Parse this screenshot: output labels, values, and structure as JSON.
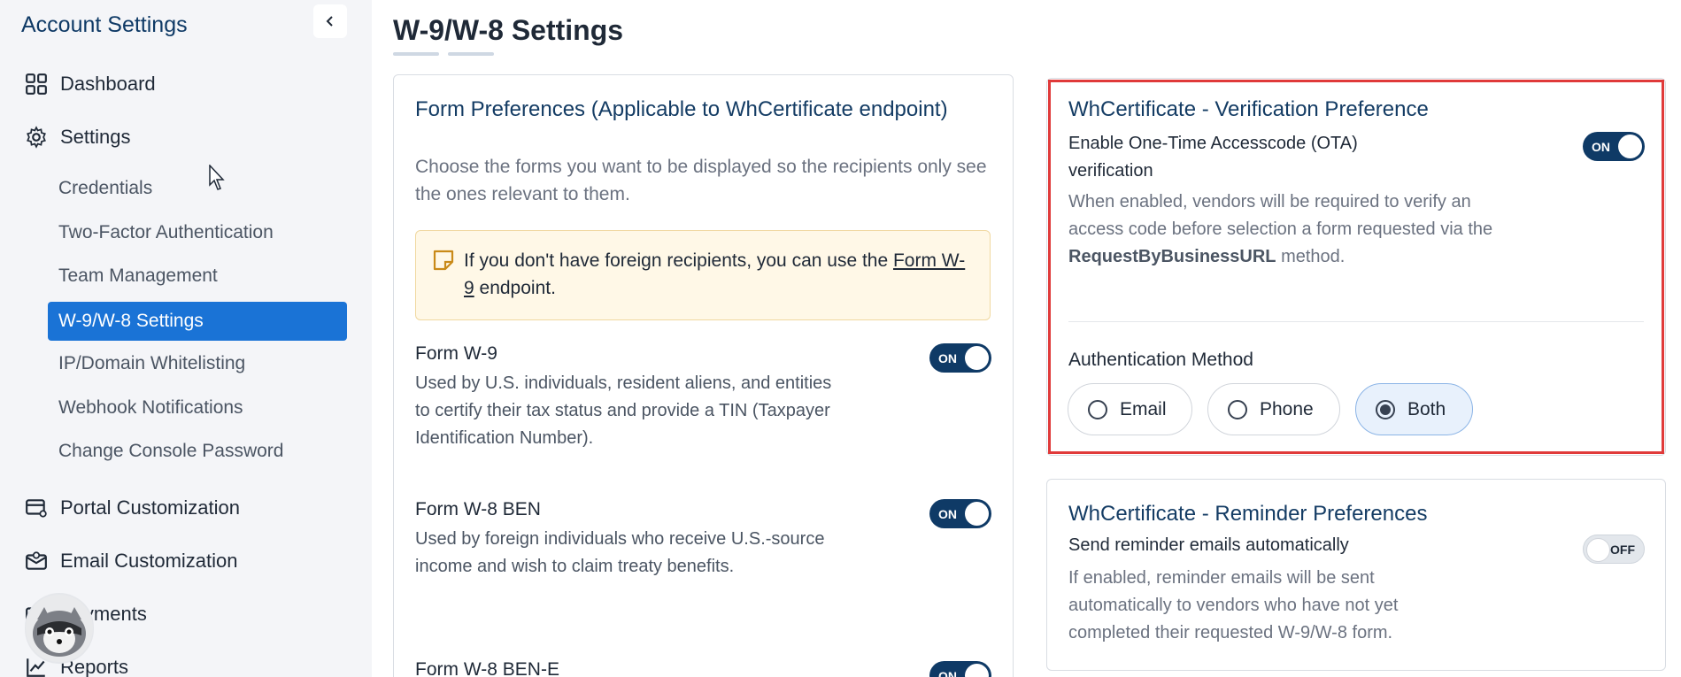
{
  "sidebar": {
    "title": "Account Settings",
    "main_items": [
      {
        "label": "Dashboard",
        "icon": "grid-icon"
      },
      {
        "label": "Settings",
        "icon": "gear-icon"
      },
      {
        "label": "Portal Customization",
        "icon": "card-settings-icon"
      },
      {
        "label": "Email Customization",
        "icon": "envelope-icon"
      },
      {
        "label": "Payments",
        "icon": "payments-icon"
      },
      {
        "label": "Reports",
        "icon": "chart-icon"
      }
    ],
    "sub_items": [
      {
        "label": "Credentials"
      },
      {
        "label": "Two-Factor Authentication"
      },
      {
        "label": "Team Management"
      },
      {
        "label": "W-9/W-8 Settings"
      },
      {
        "label": "IP/Domain Whitelisting"
      },
      {
        "label": "Webhook Notifications"
      },
      {
        "label": "Change Console Password"
      }
    ]
  },
  "page": {
    "title": "W-9/W-8 Settings"
  },
  "form_prefs": {
    "title": "Form Preferences (Applicable to WhCertificate endpoint)",
    "description": "Choose the forms you want to be displayed so the recipients only see the ones relevant to them.",
    "note_prefix": "If you don't have foreign recipients, you can use the ",
    "note_link": "Form W-9",
    "note_suffix": " endpoint.",
    "forms": [
      {
        "name": "Form W-9",
        "description": "Used by U.S. individuals, resident aliens, and entities to certify their tax status and provide a TIN (Taxpayer Identification Number).",
        "toggle": "ON"
      },
      {
        "name": "Form W-8 BEN",
        "description": "Used by foreign individuals who receive U.S.-source income and wish to claim treaty benefits.",
        "toggle": "ON"
      },
      {
        "name": "Form W-8 BEN-E",
        "description": "",
        "toggle": "ON"
      }
    ]
  },
  "verification": {
    "title": "WhCertificate - Verification Preference",
    "setting_label": "Enable One-Time Accesscode (OTA) verification",
    "toggle": "ON",
    "desc_prefix": "When enabled, vendors will be required to verify an access code before selection a form requested via the ",
    "desc_bold": "RequestByBusinessURL",
    "desc_suffix": " method.",
    "auth_label": "Authentication Method",
    "options": [
      "Email",
      "Phone",
      "Both"
    ],
    "selected": "Both"
  },
  "reminder": {
    "title": "WhCertificate - Reminder Preferences",
    "setting_label": "Send reminder emails automatically",
    "toggle": "OFF",
    "description": "If enabled, reminder emails will be sent automatically to vendors who have not yet completed their requested W-9/W-8 form."
  }
}
